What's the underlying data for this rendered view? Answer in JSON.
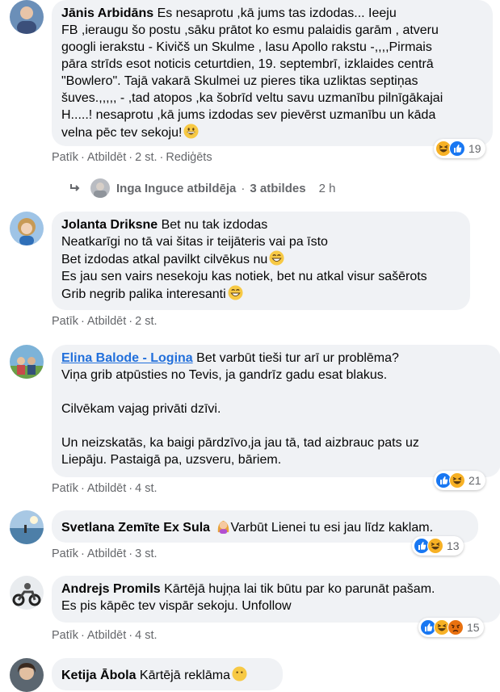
{
  "comments": [
    {
      "author": "Jānis Arbidāns",
      "lines": [
        "Es nesaprotu ,kā jums tas izdodas... Ieeju",
        "FB ,ieraugu šo postu ,sāku prātot ko esmu palaidis garām , atveru",
        "googli ierakstu - Kivičš un Skulme , lasu Apollo rakstu -,,,,Pirmais",
        "pāra strīds esot noticis ceturtdien, 19. septembrī, izklaides centrā",
        "\"Bowlero\". Tajā vakarā Skulmei uz pieres tika uzliktas septiņas",
        "šuves.,,,,, - ,tad atopos ,ka šobrīd veltu savu uzmanību pilnīgākajai",
        "H.....! nesaprotu ,kā jums izdodas sev pievērst uzmanību un kāda",
        "velna pēc tev sekoju!"
      ],
      "actions": {
        "like": "Patīk",
        "reply": "Atbildēt",
        "time": "2 st.",
        "edited": "Rediģēts"
      },
      "reactions": {
        "icons": [
          "haha-icon",
          "like-icon"
        ],
        "count": "19"
      }
    },
    {
      "author": "Jolanta Driksne",
      "lines": [
        "Bet nu tak izdodas",
        "Neatkarīgi no tā vai šitas ir teijāteris vai pa īsto",
        "Bet izdodas atkal pavilkt cilvēkus nu",
        "Es jau sen vairs nesekoju kas notiek, bet nu atkal visur sašērots",
        "Grib negrib palika interesanti"
      ],
      "actions": {
        "like": "Patīk",
        "reply": "Atbildēt",
        "time": "2 st."
      }
    },
    {
      "author": "Elina Balode - Logina",
      "lines": [
        "Bet varbūt tieši tur arī ur problēma?",
        "Viņa grib atpūsties no Tevis, ja gandrīz gadu esat blakus.",
        "",
        "Cilvēkam vajag privāti dzīvi.",
        "",
        "Un neizskatās, ka baigi pārdzīvo,ja jau tā, tad aizbrauc pats uz",
        "Liepāju. Pastaigā pa, uzsveru, bāriem."
      ],
      "actions": {
        "like": "Patīk",
        "reply": "Atbildēt",
        "time": "4 st."
      },
      "reactions": {
        "icons": [
          "like-icon",
          "haha-icon"
        ],
        "count": "21"
      }
    },
    {
      "author": "Svetlana Zemīte Ex Sula",
      "text": "Varbūt Lienei tu esi jau līdz kaklam.",
      "actions": {
        "like": "Patīk",
        "reply": "Atbildēt",
        "time": "3 st."
      },
      "reactions": {
        "icons": [
          "like-icon",
          "haha-icon"
        ],
        "count": "13"
      }
    },
    {
      "author": "Andrejs Promils",
      "lines": [
        "Kārtējā hujņa lai tik būtu par ko parunāt pašam.",
        "Es pis kāpēc tev vispār sekoju. Unfollow"
      ],
      "actions": {
        "like": "Patīk",
        "reply": "Atbildēt",
        "time": "4 st."
      },
      "reactions": {
        "icons": [
          "like-icon",
          "haha-icon",
          "angry-icon"
        ],
        "count": "15"
      }
    },
    {
      "author": "Ketija Ābola",
      "text": "Kārtējā reklāma"
    }
  ],
  "replies": {
    "name": "Inga Inguce atbildēja",
    "count": "3 atbildes",
    "time": "2 h"
  },
  "colors": {
    "bubble": "#f0f2f5",
    "link": "#216fdb",
    "like": "#1877f2",
    "haha": "#f7b125",
    "angry": "#e9710f",
    "meta": "#65676b"
  }
}
